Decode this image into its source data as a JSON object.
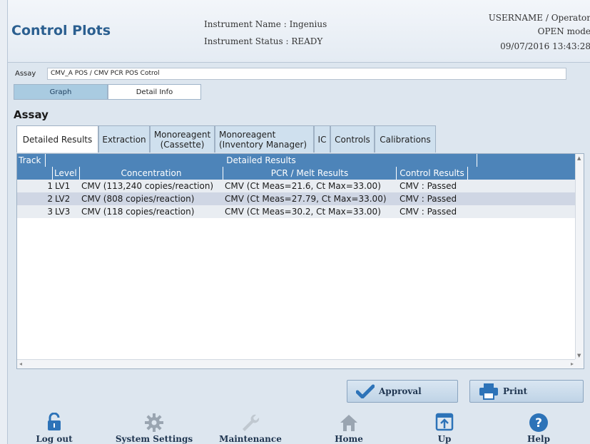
{
  "header": {
    "title": "Control Plots",
    "instrument_name": "Instrument Name : Ingenius",
    "instrument_status": "Instrument Status : READY",
    "user": "USERNAME / Operator",
    "mode": "OPEN mode",
    "datetime": "09/07/2016 13:43:28"
  },
  "assay": {
    "label": "Assay",
    "value": "CMV_A POS / CMV PCR POS Cotrol"
  },
  "view_tabs": [
    {
      "label": "Graph",
      "active": true
    },
    {
      "label": "Detail Info",
      "active": false
    }
  ],
  "section_title": "Assay",
  "sub_tabs": [
    {
      "label": "Detailed Results",
      "active": true
    },
    {
      "label": "Extraction",
      "active": false
    },
    {
      "label": "Monoreagent\n(Cassette)",
      "active": false
    },
    {
      "label": "Monoreagent\n(Inventory Manager)",
      "active": false
    },
    {
      "label": "IC",
      "active": false
    },
    {
      "label": "Controls",
      "active": false
    },
    {
      "label": "Calibrations",
      "active": false
    }
  ],
  "table": {
    "header_top": {
      "track": "Track",
      "detailed": "Detailed Results"
    },
    "columns": [
      "Level",
      "Concentration",
      "PCR / Melt Results",
      "Control Results"
    ],
    "rows": [
      {
        "track": "1",
        "level": "LV1",
        "concentration": "CMV (113,240 copies/reaction)",
        "pcr": "CMV (Ct Meas=21.6, Ct Max=33.00)",
        "control": "CMV : Passed"
      },
      {
        "track": "2",
        "level": "LV2",
        "concentration": "CMV (808 copies/reaction)",
        "pcr": "CMV (Ct Meas=27.79, Ct Max=33.00)",
        "control": "CMV : Passed"
      },
      {
        "track": "3",
        "level": "LV3",
        "concentration": "CMV (118 copies/reaction)",
        "pcr": "CMV (Ct Meas=30.2, Ct Max=33.00)",
        "control": "CMV : Passed"
      }
    ]
  },
  "actions": {
    "approval": "Approval",
    "print": "Print"
  },
  "footer_nav": {
    "logout": "Log out",
    "system_settings": "System Settings",
    "maintenance": "Maintenance",
    "home": "Home",
    "up": "Up",
    "help": "Help"
  },
  "colors": {
    "title": "#2b5f90",
    "table_header": "#4d84b9",
    "accent": "#2d73b8"
  }
}
